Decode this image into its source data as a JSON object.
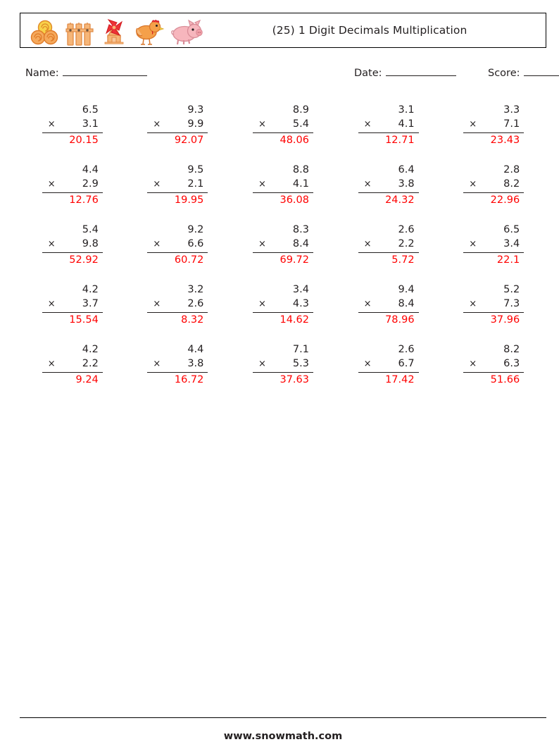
{
  "header": {
    "title": "(25) 1 Digit Decimals Multiplication",
    "icons": [
      "hay-bales-icon",
      "fence-icon",
      "windmill-icon",
      "chicken-icon",
      "pig-icon"
    ]
  },
  "meta": {
    "name_label": "Name:",
    "date_label": "Date:",
    "score_label": "Score:"
  },
  "problems": {
    "operator": "×",
    "items": [
      {
        "top": "6.5",
        "bottom": "3.1",
        "answer": "20.15"
      },
      {
        "top": "9.3",
        "bottom": "9.9",
        "answer": "92.07"
      },
      {
        "top": "8.9",
        "bottom": "5.4",
        "answer": "48.06"
      },
      {
        "top": "3.1",
        "bottom": "4.1",
        "answer": "12.71"
      },
      {
        "top": "3.3",
        "bottom": "7.1",
        "answer": "23.43"
      },
      {
        "top": "4.4",
        "bottom": "2.9",
        "answer": "12.76"
      },
      {
        "top": "9.5",
        "bottom": "2.1",
        "answer": "19.95"
      },
      {
        "top": "8.8",
        "bottom": "4.1",
        "answer": "36.08"
      },
      {
        "top": "6.4",
        "bottom": "3.8",
        "answer": "24.32"
      },
      {
        "top": "2.8",
        "bottom": "8.2",
        "answer": "22.96"
      },
      {
        "top": "5.4",
        "bottom": "9.8",
        "answer": "52.92"
      },
      {
        "top": "9.2",
        "bottom": "6.6",
        "answer": "60.72"
      },
      {
        "top": "8.3",
        "bottom": "8.4",
        "answer": "69.72"
      },
      {
        "top": "2.6",
        "bottom": "2.2",
        "answer": "5.72"
      },
      {
        "top": "6.5",
        "bottom": "3.4",
        "answer": "22.1"
      },
      {
        "top": "4.2",
        "bottom": "3.7",
        "answer": "15.54"
      },
      {
        "top": "3.2",
        "bottom": "2.6",
        "answer": "8.32"
      },
      {
        "top": "3.4",
        "bottom": "4.3",
        "answer": "14.62"
      },
      {
        "top": "9.4",
        "bottom": "8.4",
        "answer": "78.96"
      },
      {
        "top": "5.2",
        "bottom": "7.3",
        "answer": "37.96"
      },
      {
        "top": "4.2",
        "bottom": "2.2",
        "answer": "9.24"
      },
      {
        "top": "4.4",
        "bottom": "3.8",
        "answer": "16.72"
      },
      {
        "top": "7.1",
        "bottom": "5.3",
        "answer": "37.63"
      },
      {
        "top": "2.6",
        "bottom": "6.7",
        "answer": "17.42"
      },
      {
        "top": "8.2",
        "bottom": "6.3",
        "answer": "51.66"
      }
    ]
  },
  "footer": {
    "site": "www.snowmath.com"
  },
  "colors": {
    "answer_red": "#ff0000",
    "text": "#231f20",
    "border": "#000000"
  }
}
